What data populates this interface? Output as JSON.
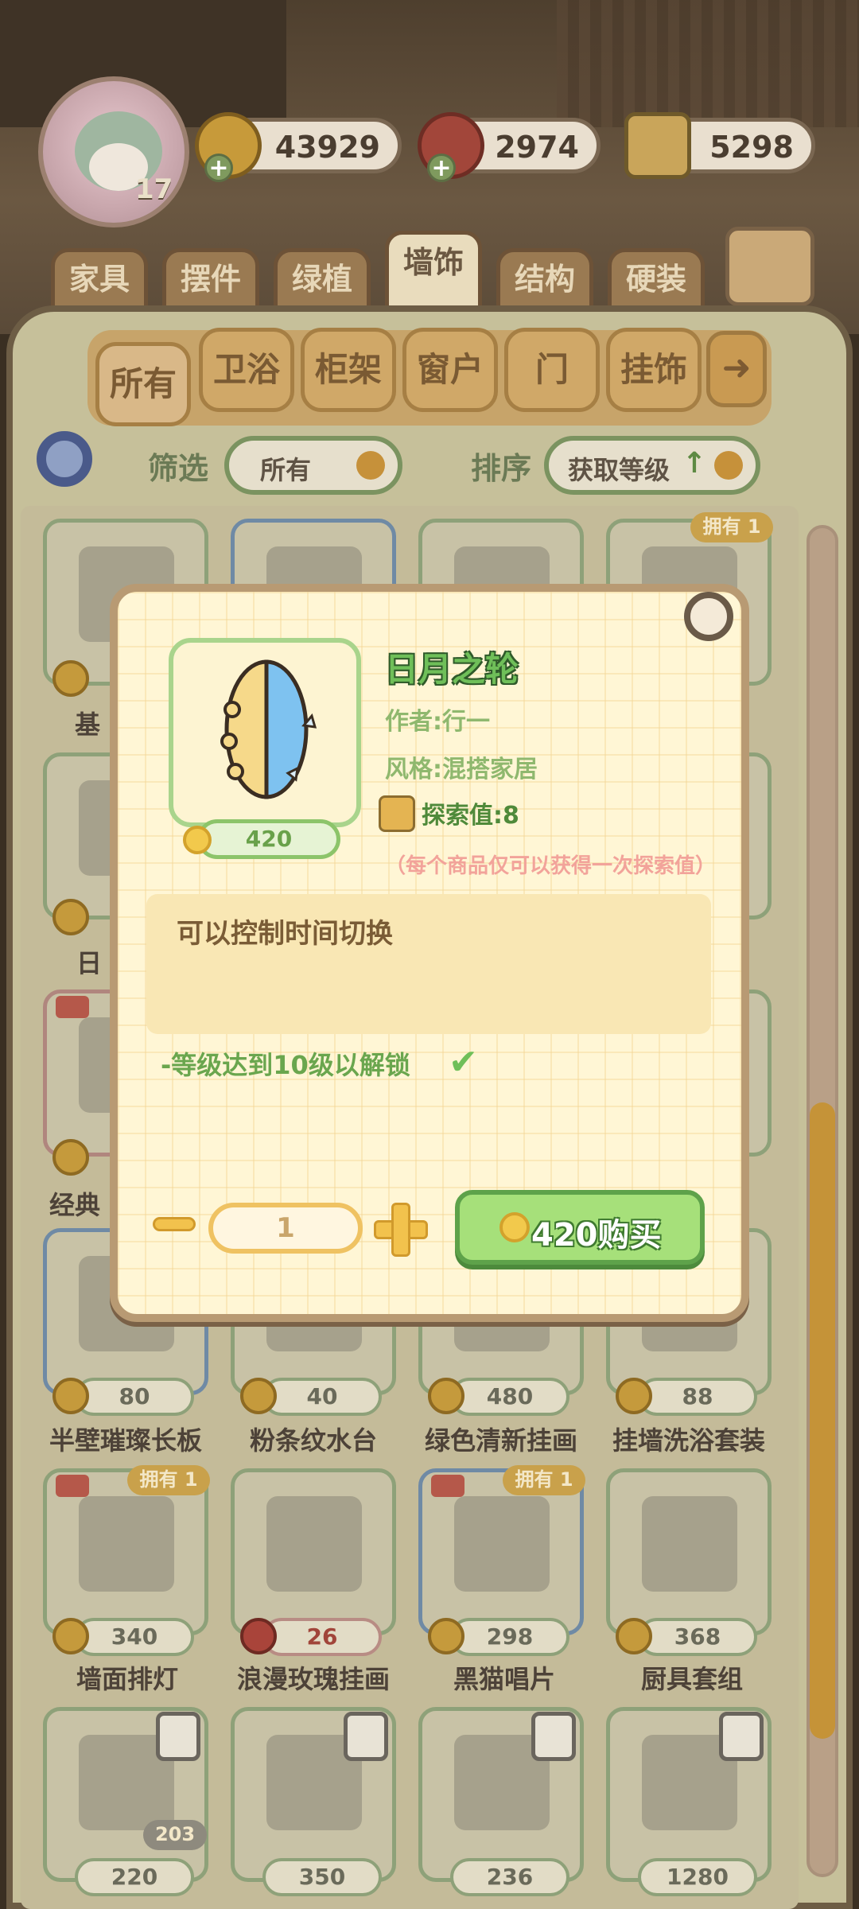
{
  "player": {
    "level": "17"
  },
  "currency": [
    {
      "icon": "coin-icon",
      "value": "43929"
    },
    {
      "icon": "tomato-icon",
      "value": "2974"
    },
    {
      "icon": "book-icon",
      "value": "5298"
    }
  ],
  "category_tabs": [
    {
      "label": "家具"
    },
    {
      "label": "摆件"
    },
    {
      "label": "绿植"
    },
    {
      "label": "墙饰"
    },
    {
      "label": "结构"
    },
    {
      "label": "硬装"
    }
  ],
  "active_category": "墙饰",
  "sub_tabs": [
    {
      "label": "所有"
    },
    {
      "label": "卫浴"
    },
    {
      "label": "柜架"
    },
    {
      "label": "窗户"
    },
    {
      "label": "门"
    },
    {
      "label": "挂饰"
    }
  ],
  "filter": {
    "filter_label": "筛选",
    "filter_value": "所有",
    "sort_label": "排序",
    "sort_value": "获取等级"
  },
  "partial_names": {
    "row1": "基",
    "row2": "日",
    "row3": "经典"
  },
  "partial_owned": "拥有 1",
  "items_row4": [
    {
      "name": "半壁璀璨长板",
      "price": "80"
    },
    {
      "name": "粉条纹水台",
      "price": "40"
    },
    {
      "name": "绿色清新挂画",
      "price": "480"
    },
    {
      "name": "挂墙洗浴套装",
      "price": "88"
    }
  ],
  "items_row5": [
    {
      "name": "墙面排灯",
      "price": "340",
      "owned": "拥有 1"
    },
    {
      "name": "浪漫玫瑰挂画",
      "price": "26"
    },
    {
      "name": "黑猫唱片",
      "price": "298",
      "owned": "拥有 1"
    },
    {
      "name": "厨具套组",
      "price": "368"
    }
  ],
  "items_row6": [
    {
      "price": "220",
      "badge": "203"
    },
    {
      "price": "350"
    },
    {
      "price": "236"
    },
    {
      "price": "1280"
    }
  ],
  "modal": {
    "title": "日月之轮",
    "author": "作者:行一",
    "style": "风格:混搭家居",
    "explore": "探索值:8",
    "note": "（每个商品仅可以获得一次探索值）",
    "price": "420",
    "description": "可以控制时间切换",
    "unlock": "-等级达到10级以解锁",
    "quantity": "1",
    "buy_label": "420购买"
  },
  "colors": {
    "accent_green": "#6fbf59",
    "coin_gold": "#f2c94c",
    "modal_bg": "#fff6d5"
  }
}
